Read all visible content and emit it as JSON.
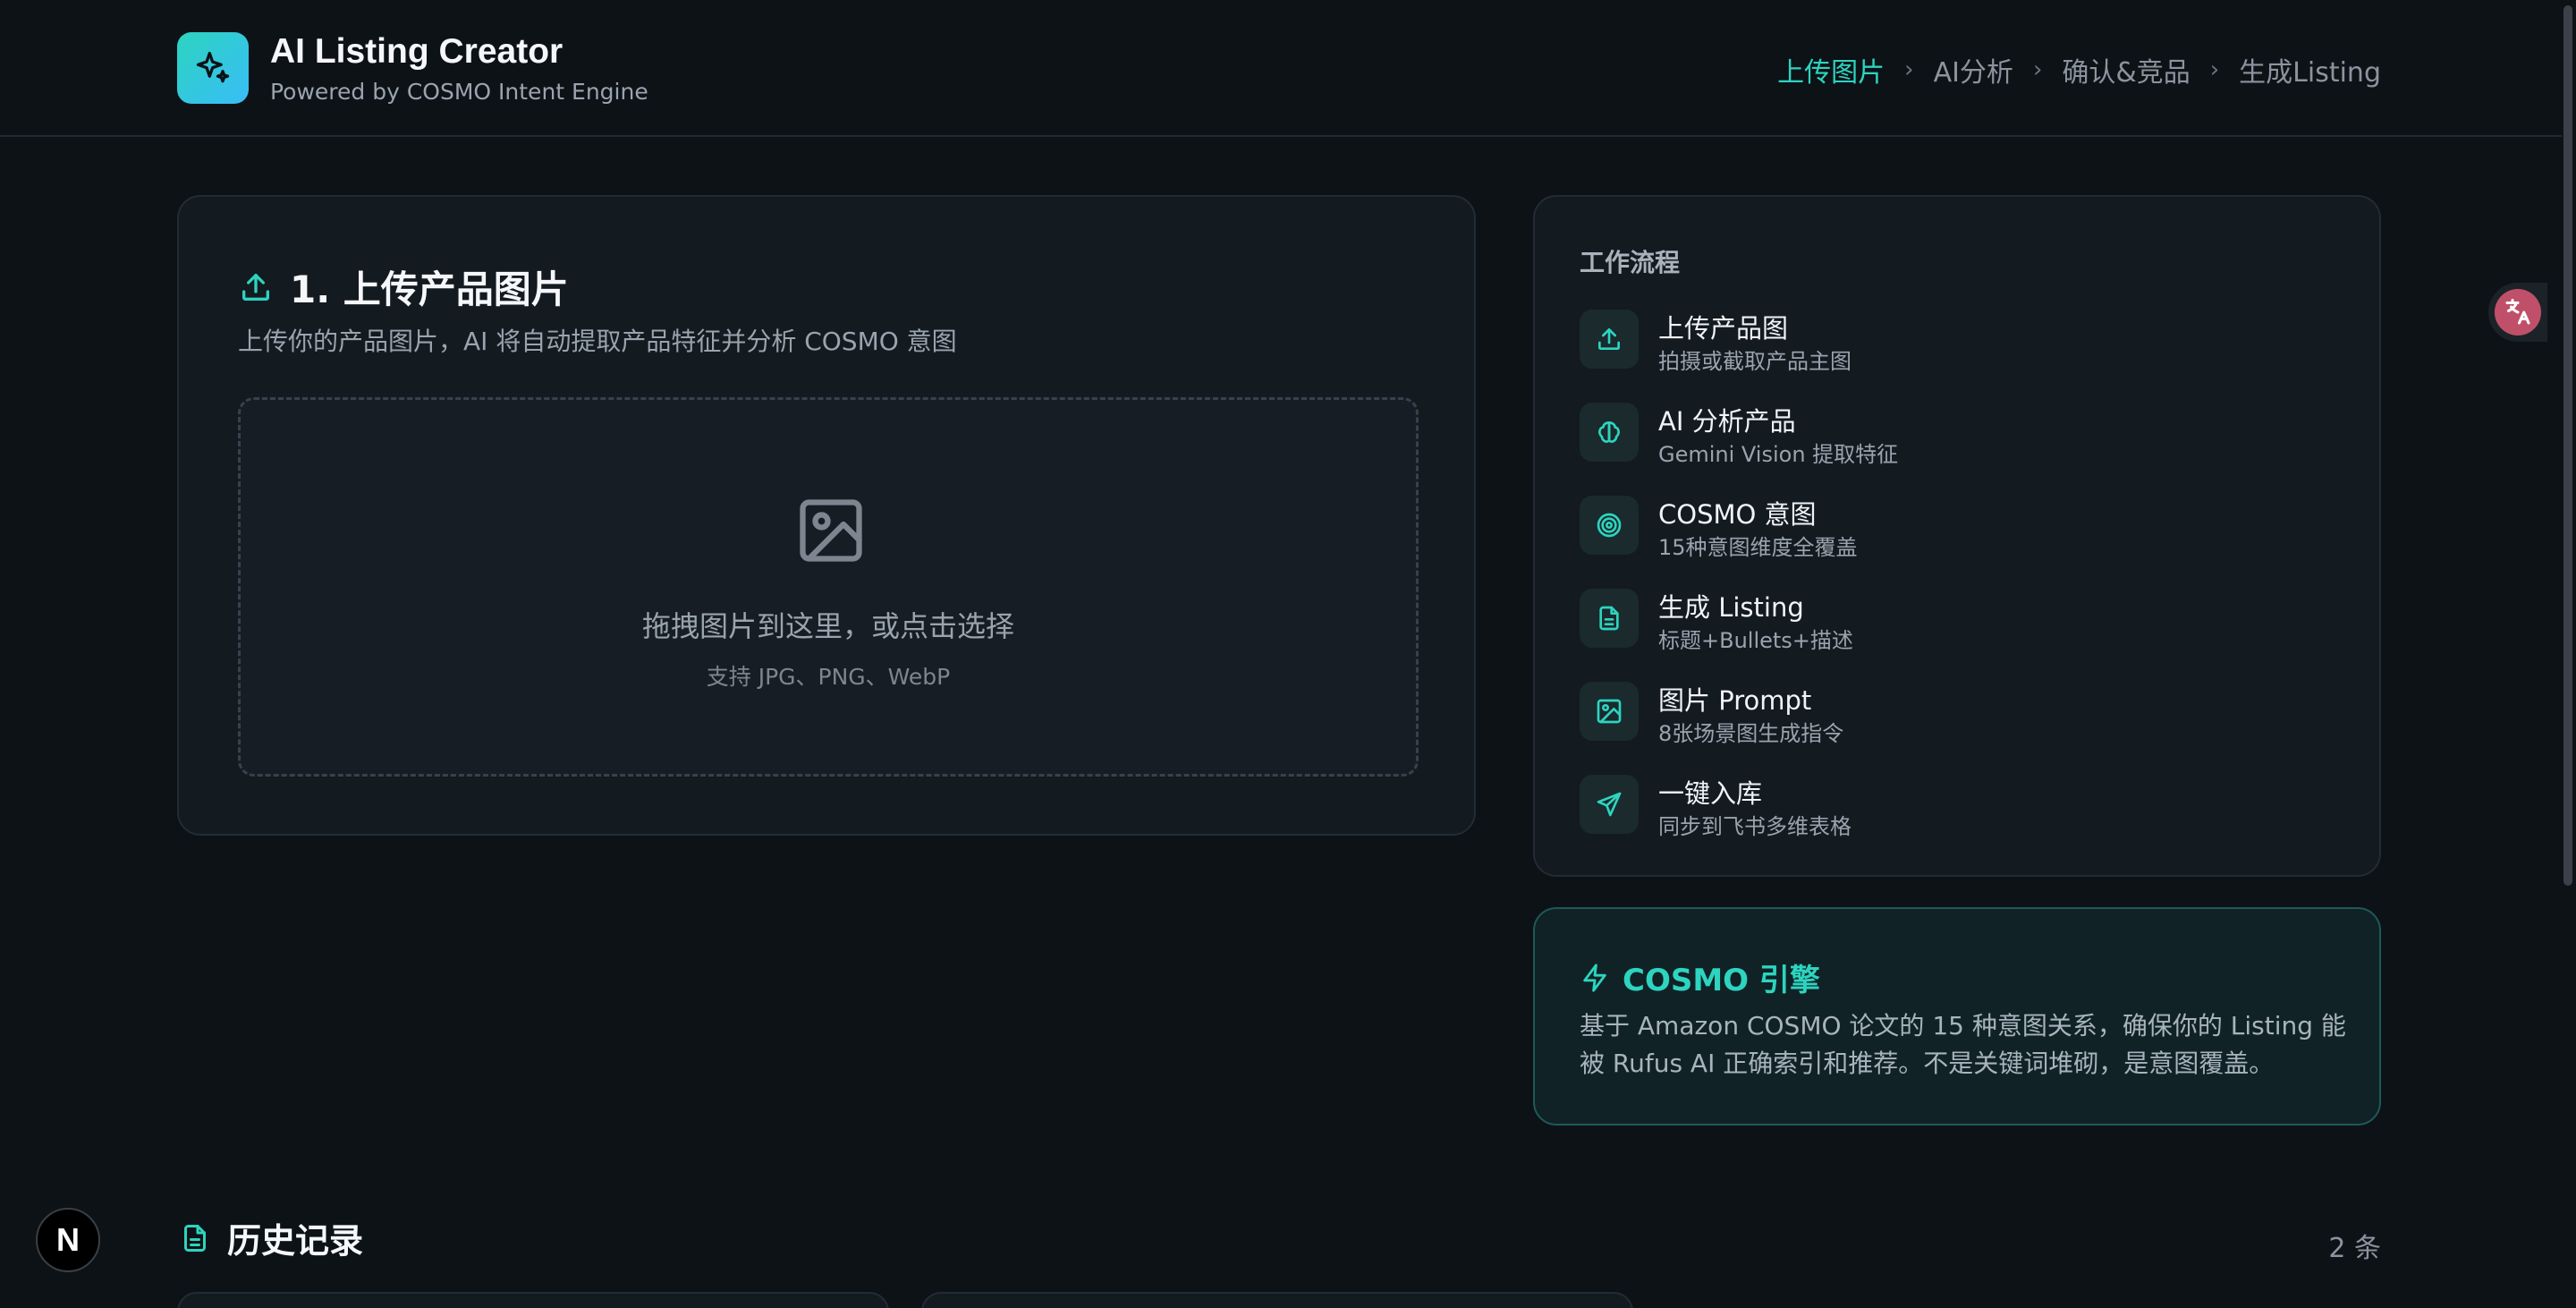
{
  "header": {
    "title": "AI Listing Creator",
    "subtitle": "Powered by COSMO Intent Engine",
    "steps": [
      "上传图片",
      "AI分析",
      "确认&竞品",
      "生成Listing"
    ],
    "active_step": 0,
    "logo_icon": "sparkle-icon"
  },
  "upload": {
    "title": "1. 上传产品图片",
    "description": "上传你的产品图片，AI 将自动提取产品特征并分析 COSMO 意图",
    "drop_text": "拖拽图片到这里，或点击选择",
    "drop_hint": "支持 JPG、PNG、WebP"
  },
  "workflow": {
    "heading": "工作流程",
    "items": [
      {
        "title": "上传产品图",
        "desc": "拍摄或截取产品主图",
        "icon": "upload-icon"
      },
      {
        "title": "AI 分析产品",
        "desc": "Gemini Vision 提取特征",
        "icon": "brain-icon"
      },
      {
        "title": "COSMO 意图",
        "desc": "15种意图维度全覆盖",
        "icon": "target-icon"
      },
      {
        "title": "生成 Listing",
        "desc": "标题+Bullets+描述",
        "icon": "document-icon"
      },
      {
        "title": "图片 Prompt",
        "desc": "8张场景图生成指令",
        "icon": "image-icon"
      },
      {
        "title": "一键入库",
        "desc": "同步到飞书多维表格",
        "icon": "send-icon"
      }
    ]
  },
  "cosmo": {
    "title": "COSMO 引擎",
    "text": "基于 Amazon COSMO 论文的 15 种意图关系，确保你的 Listing 能被 Rufus AI 正确索引和推荐。不是关键词堆砌，是意图覆盖。"
  },
  "history": {
    "title": "历史记录",
    "count": "2 条"
  },
  "badge": {
    "label": "N"
  },
  "colors": {
    "accent": "#2dd4bf",
    "background": "#0d1217",
    "card": "#131a20"
  }
}
